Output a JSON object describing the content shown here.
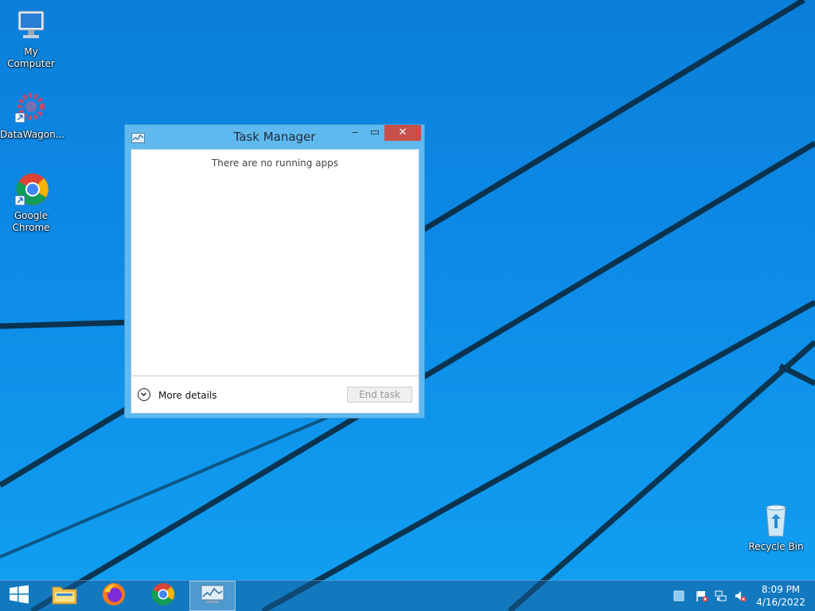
{
  "desktop": {
    "icons": [
      {
        "label": "My Computer",
        "icon": "computer-icon"
      },
      {
        "label": "DataWagon...",
        "icon": "datawagon-icon"
      },
      {
        "label": "Google Chrome",
        "icon": "chrome-icon"
      },
      {
        "label": "Recycle Bin",
        "icon": "recycle-bin-icon"
      }
    ]
  },
  "window": {
    "title": "Task Manager",
    "minimize_glyph": "‒",
    "maximize_glyph": "▭",
    "close_glyph": "✕",
    "empty_message": "There are no running apps",
    "more_details_label": "More details",
    "end_task_label": "End task"
  },
  "taskbar": {
    "items": [
      {
        "name": "start-button",
        "icon": "windows-logo-icon"
      },
      {
        "name": "file-explorer",
        "icon": "folder-icon"
      },
      {
        "name": "firefox",
        "icon": "firefox-icon"
      },
      {
        "name": "chrome",
        "icon": "chrome-icon"
      },
      {
        "name": "task-manager",
        "icon": "task-manager-icon",
        "active": true
      }
    ],
    "tray": [
      "action-center-icon",
      "flag-icon",
      "network-icon",
      "volume-muted-icon"
    ],
    "clock": {
      "time": "8:09 PM",
      "date": "4/16/2022"
    }
  },
  "colors": {
    "wallpaper": "#0d8ae6",
    "window_frame": "#5fb9ee",
    "close_button": "#c7504a"
  }
}
